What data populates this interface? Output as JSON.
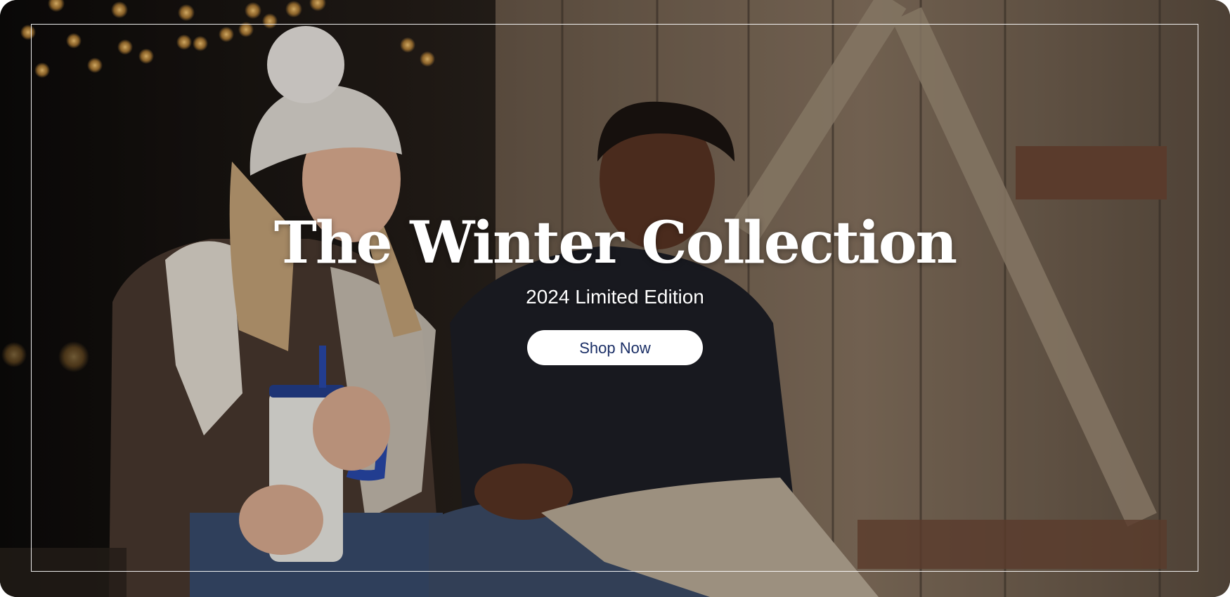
{
  "hero": {
    "title": "The Winter Collection",
    "subtitle": "2024 Limited Edition",
    "cta_label": "Shop Now"
  },
  "colors": {
    "cta_background": "#ffffff",
    "cta_text": "#1b2f66",
    "frame": "#ffffff",
    "title_text": "#ffffff"
  }
}
